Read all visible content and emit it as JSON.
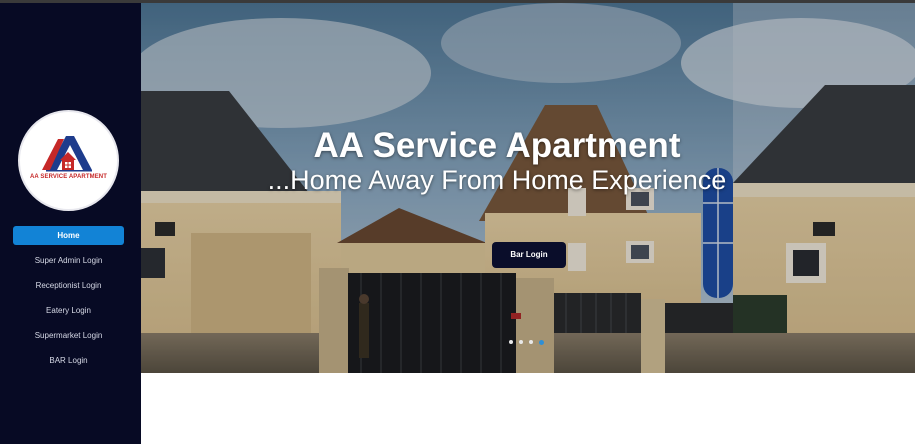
{
  "brand": {
    "logo_text": "AA SERVICE APARTMENT",
    "colors": {
      "sidebar_bg": "#070a24",
      "accent": "#1283d6",
      "logo_red": "#c62828",
      "logo_blue": "#1e3c8c"
    }
  },
  "sidebar": {
    "items": [
      {
        "label": "Home",
        "active": true
      },
      {
        "label": "Super Admin Login",
        "active": false
      },
      {
        "label": "Receptionist Login",
        "active": false
      },
      {
        "label": "Eatery Login",
        "active": false
      },
      {
        "label": "Supermarket Login",
        "active": false
      },
      {
        "label": "BAR Login",
        "active": false
      }
    ]
  },
  "hero": {
    "title": "AA Service Apartment",
    "subtitle": "...Home Away From Home Experience",
    "button_label": "Bar Login",
    "carousel": {
      "slide_count": 4,
      "active_index": 3
    }
  }
}
